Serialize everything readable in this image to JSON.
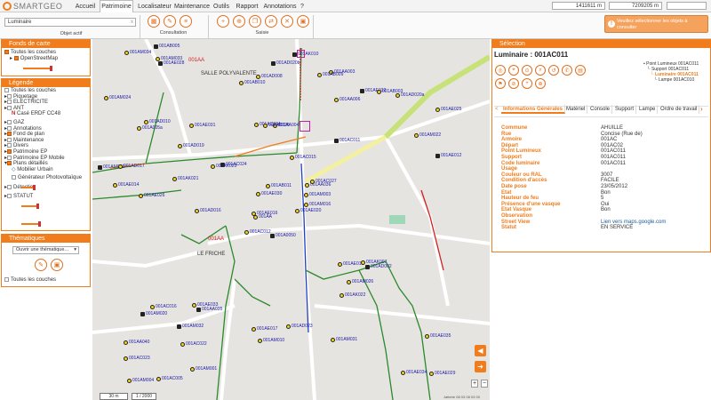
{
  "app": {
    "logo_text": "SMARTGEO"
  },
  "menu": [
    {
      "label": "Accueil"
    },
    {
      "label": "Patrimoine"
    },
    {
      "label": "Localisateur"
    },
    {
      "label": "Maintenance"
    },
    {
      "label": "Outils"
    },
    {
      "label": "Rapport"
    },
    {
      "label": "Annotations"
    },
    {
      "label": "?"
    }
  ],
  "coords": {
    "x": "1411611 m",
    "y": "7209205 m"
  },
  "toolbar": {
    "search_value": "Luminaire",
    "search_clear": "x",
    "objet_actif": "Objet actif",
    "group_consultation": "Consultation",
    "group_saisie": "Saisie"
  },
  "warning": {
    "icon": "!",
    "text": "Veuillez sélectionner les objets à consulter"
  },
  "fonds": {
    "title": "Fonds de carte",
    "items": [
      {
        "label": "Toutes les couches"
      },
      {
        "label": "OpenStreetMap"
      }
    ]
  },
  "legende": {
    "title": "Légende",
    "items": [
      {
        "label": "Toutes les couches"
      },
      {
        "label": "Piquetage"
      },
      {
        "label": "ELECTRICITE"
      },
      {
        "label": "ANT"
      },
      {
        "label": "Casé ERDF CC48"
      },
      {
        "label": "GAZ"
      },
      {
        "label": "Annotations"
      },
      {
        "label": "Fond de plan"
      },
      {
        "label": "Maintenance"
      },
      {
        "label": "Divers"
      },
      {
        "label": "Patrimoine EP"
      },
      {
        "label": "Patrimoine EP Mobile"
      },
      {
        "label": "Plans détaillés"
      },
      {
        "label": "Mobilier Urbain"
      },
      {
        "label": "Générateur Photovoltaïque"
      },
      {
        "label": "Détection"
      },
      {
        "label": "STATUT"
      }
    ]
  },
  "thematiques": {
    "title": "Thématiques",
    "select_value": "Ouvrir une thématique...",
    "all_layers": "Toutes les couches"
  },
  "map": {
    "places": [
      {
        "text": "SALLE POLYVALENTE"
      },
      {
        "text": "LE FRICHE"
      },
      {
        "text": "001AA"
      },
      {
        "text": "001AA"
      }
    ],
    "labels": [
      "001A0050",
      "001A005a",
      "001AA",
      "001AA040",
      "001AA036",
      "001AA035",
      "001AA003",
      "001AA004",
      "001AA006",
      "001AE020",
      "001AE028",
      "001AE029",
      "001AE026",
      "001AE025",
      "001AC012",
      "001AC011",
      "001AC005",
      "001AC004",
      "001AC015",
      "001AC016",
      "001AC024",
      "001AC023",
      "001AC022",
      "001AC026",
      "001AC027",
      "001AD002",
      "001AD010",
      "001AD008",
      "001AE014",
      "001AE013",
      "001AE012",
      "001AE016",
      "001AE017",
      "001AE030",
      "001AE031",
      "001AE032",
      "001AE033",
      "001AE034",
      "001AE035",
      "001AK007",
      "001AK010",
      "001AK020",
      "001AK021",
      "001AK022",
      "001AM001",
      "001AM002",
      "001AM003",
      "001AM004",
      "001AM010",
      "001AM016",
      "001AM020",
      "001AM022",
      "001AM024",
      "001AM026",
      "001AM031",
      "001AM032",
      "001AM033",
      "001AM034",
      "001AD023",
      "001AD020a",
      "001AD020b",
      "001AD016",
      "001AD017",
      "001AD019",
      "001AB003",
      "001AB005",
      "001AB009",
      "001AB010",
      "001AB011"
    ],
    "scale_m": "30 m",
    "scale_ratio": "1 / 2000",
    "attribution": "Jatterie 08 03 08 03 00",
    "zoom": {
      "plus": "+",
      "minus": "−"
    }
  },
  "selection": {
    "title": "Sélection",
    "object_title": "Luminaire : 001AC011",
    "tree": [
      {
        "label": "Point Lumineux 001AC011"
      },
      {
        "label": "Support 001AC011"
      },
      {
        "label": "Luminaire 001AC011"
      },
      {
        "label": "Lampe 001AC010"
      }
    ],
    "tabs": [
      {
        "label": "Informations Générales"
      },
      {
        "label": "Matériel"
      },
      {
        "label": "Console"
      },
      {
        "label": "Support"
      },
      {
        "label": "Lampe"
      },
      {
        "label": "Ordre de travail"
      }
    ],
    "fields": [
      {
        "key": "Commune",
        "value": "AHUILLE"
      },
      {
        "key": "Rue",
        "value": "Concise (Rue de)"
      },
      {
        "key": "Armoire",
        "value": "001AC"
      },
      {
        "key": "Départ",
        "value": "001AC02"
      },
      {
        "key": "Point Lumineux",
        "value": "001AC011"
      },
      {
        "key": "Support",
        "value": "001AC011"
      },
      {
        "key": "Code luminaire",
        "value": "001AC011"
      },
      {
        "key": "Usage",
        "value": ""
      },
      {
        "key": "Couleur ou RAL",
        "value": "3007"
      },
      {
        "key": "Condition d'accès",
        "value": "FACILE"
      },
      {
        "key": "Date pose",
        "value": "23/05/2012"
      },
      {
        "key": "Etat",
        "value": "Bon"
      },
      {
        "key": "Hauteur de feu",
        "value": "5"
      },
      {
        "key": "Présence d'une vasque",
        "value": "Oui"
      },
      {
        "key": "Etat Vasque",
        "value": "Bon"
      },
      {
        "key": "Observation",
        "value": ""
      },
      {
        "key": "Street View",
        "value": "Lien vers maps.google.com"
      },
      {
        "key": "Statut",
        "value": "EN SERVICE"
      }
    ]
  },
  "colors": {
    "accent": "#f07c1b",
    "label_blue": "#1a1aa8",
    "line_green": "#2a8a2a",
    "line_red": "#d02020",
    "line_blue": "#2040c0"
  }
}
